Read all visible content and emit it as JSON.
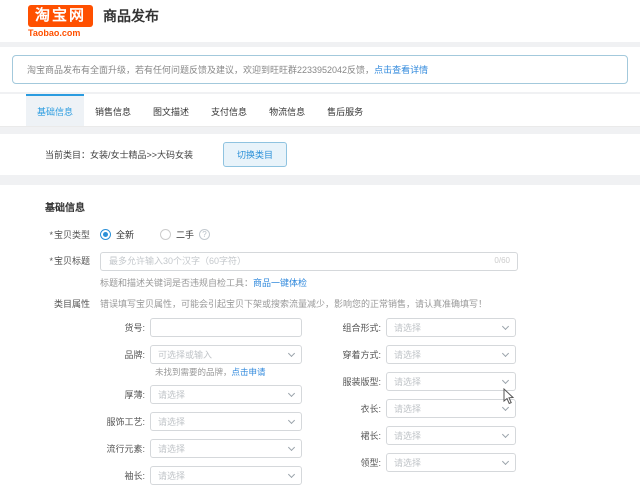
{
  "header": {
    "logo_text": "淘宝网",
    "logo_domain": "Taobao.com",
    "page_title": "商品发布"
  },
  "notice": {
    "text": "淘宝商品发布有全面升级，若有任何问题反馈及建议，欢迎到旺旺群2233952042反馈，",
    "link_text": "点击查看详情"
  },
  "tabs": [
    {
      "label": "基础信息",
      "active": true
    },
    {
      "label": "销售信息",
      "active": false
    },
    {
      "label": "图文描述",
      "active": false
    },
    {
      "label": "支付信息",
      "active": false
    },
    {
      "label": "物流信息",
      "active": false
    },
    {
      "label": "售后服务",
      "active": false
    }
  ],
  "category_bar": {
    "current_label": "当前类目：女装/女士精品>>大码女装",
    "switch_button": "切换类目"
  },
  "basic_section": {
    "title": "基础信息"
  },
  "item_type": {
    "required_mark": "*",
    "label": "宝贝类型",
    "option_new": "全新",
    "option_used": "二手",
    "option_new_selected": true
  },
  "item_title": {
    "required_mark": "*",
    "label": "宝贝标题",
    "placeholder": "最多允许输入30个汉字（60字符）",
    "value": "",
    "counter": "0/60",
    "hint_text": "标题和描述关键词是否违规自检工具：",
    "hint_link": "商品一键体检"
  },
  "category_attrs": {
    "label": "类目属性",
    "warning": "错误填写宝贝属性，可能会引起宝贝下架或搜索流量减少，影响您的正常销售，请认真准确填写！"
  },
  "fields_left": [
    {
      "label": "货号:",
      "type": "input",
      "value": ""
    },
    {
      "label": "品牌:",
      "type": "select",
      "value": "可选择或输入",
      "hint_text": "未找到需要的品牌，",
      "hint_link": "点击申请"
    },
    {
      "label": "厚薄:",
      "type": "select",
      "value": "请选择"
    },
    {
      "label": "服饰工艺:",
      "type": "select",
      "value": "请选择"
    },
    {
      "label": "流行元素:",
      "type": "select",
      "value": "请选择"
    },
    {
      "label": "袖长:",
      "type": "select",
      "value": "请选择"
    }
  ],
  "fields_right": [
    {
      "label": "组合形式:",
      "type": "select",
      "value": "请选择"
    },
    {
      "label": "穿着方式:",
      "type": "select",
      "value": "请选择"
    },
    {
      "label": "服装版型:",
      "type": "select",
      "value": "请选择"
    },
    {
      "label": "衣长:",
      "type": "select",
      "value": "请选择"
    },
    {
      "label": "裙长:",
      "type": "select",
      "value": "请选择"
    },
    {
      "label": "领型:",
      "type": "select",
      "value": "请选择"
    }
  ],
  "icons": {
    "help": "?"
  },
  "colors": {
    "brand_orange": "#ff5000",
    "accent_blue": "#2b90d8",
    "link_blue": "#3089dc",
    "active_tab_bg": "#eef2f6",
    "notice_border": "#a3c9dc",
    "page_bg": "#f0f1f3"
  }
}
